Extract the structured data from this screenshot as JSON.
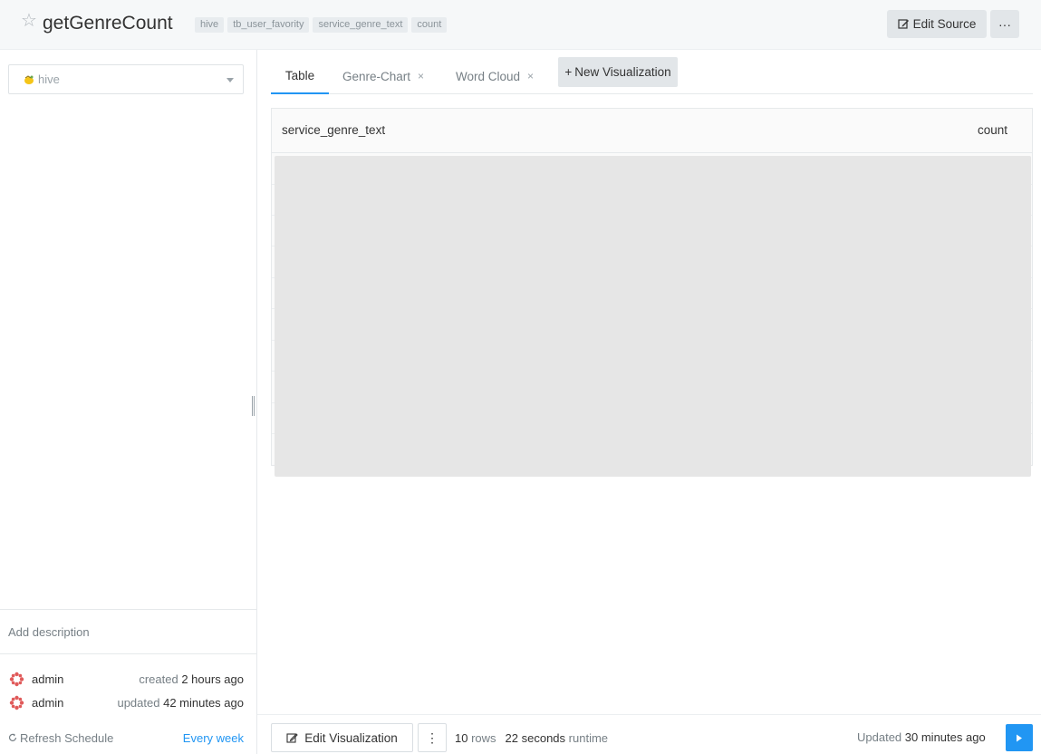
{
  "header": {
    "title": "getGenreCount",
    "tags": [
      "hive",
      "tb_user_favority",
      "service_genre_text",
      "count"
    ],
    "edit_source_label": "Edit Source",
    "more_label": "···"
  },
  "sidebar": {
    "datasource": "hive",
    "add_description": "Add description",
    "created": {
      "user": "admin",
      "label": "created",
      "time": "2 hours ago"
    },
    "updated": {
      "user": "admin",
      "label": "updated",
      "time": "42 minutes ago"
    },
    "refresh_label": "Refresh Schedule",
    "refresh_value": "Every week"
  },
  "tabs": [
    {
      "label": "Table",
      "active": true
    },
    {
      "label": "Genre-Chart",
      "close": "×"
    },
    {
      "label": "Word Cloud",
      "close": "×"
    }
  ],
  "new_viz_label": "New Visualization",
  "table": {
    "columns": [
      "service_genre_text",
      "count"
    ]
  },
  "footer": {
    "edit_viz_label": "Edit Visualization",
    "kebab": "⋮",
    "rows_count": "10",
    "rows_label": "rows",
    "runtime_value": "22 seconds",
    "runtime_label": "runtime",
    "updated_label": "Updated",
    "updated_value": "30 minutes ago"
  },
  "colors": {
    "accent": "#2196f3",
    "header_bg": "#f6f8f9",
    "tag_bg": "#e8ecef"
  }
}
